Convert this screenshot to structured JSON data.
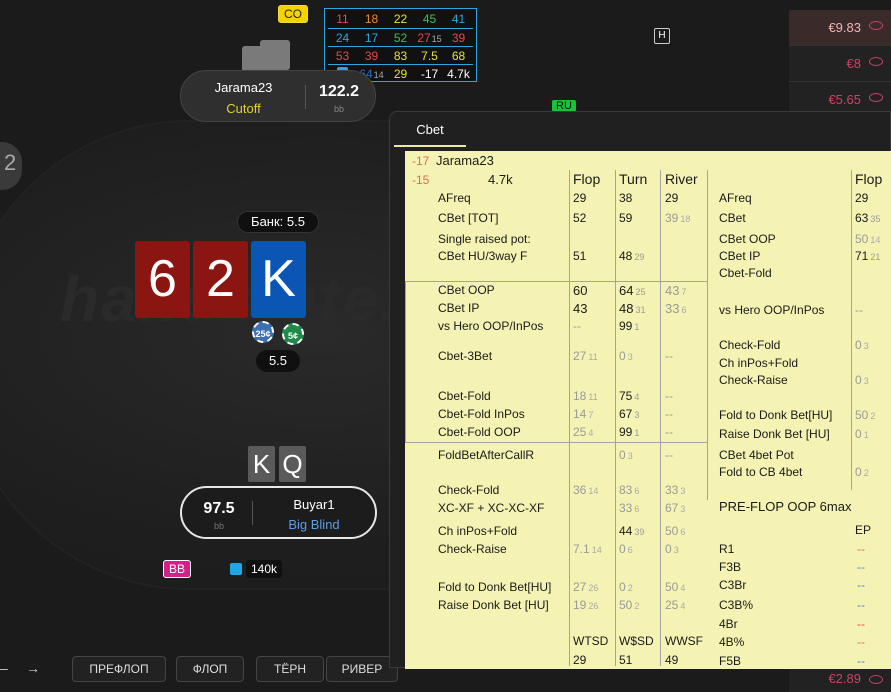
{
  "opponent": {
    "badge": "CO",
    "name": "Jarama23",
    "position": "Cutoff",
    "stack": "122.2",
    "stack_unit": "bb",
    "badge_ru": "RU"
  },
  "hud": {
    "rows": [
      [
        "11",
        "18",
        "22",
        "45",
        "41"
      ],
      [
        "24",
        "17",
        "52",
        "27",
        "39"
      ],
      [
        "53",
        "39",
        "83",
        "7.5",
        "68"
      ],
      [
        "",
        "64",
        "29",
        "-17",
        "4.7k"
      ]
    ],
    "row2_sub": "15",
    "row4_sub": "14",
    "colors": {
      "red": "#e64a4a",
      "orange": "#f08a2a",
      "yellow": "#e8e03a",
      "green": "#3ac24a",
      "cyan": "#2aa6e0"
    }
  },
  "pot": {
    "label": "Банк: 5.5",
    "amount": "5.5",
    "chips": [
      "25¢",
      "5¢"
    ]
  },
  "board": [
    "6",
    "2",
    "K"
  ],
  "hero": {
    "cards": [
      "K",
      "Q"
    ],
    "name": "Buyar1",
    "position": "Big Blind",
    "stack": "97.5",
    "stack_unit": "bb",
    "badge": "BB",
    "bet": "140k"
  },
  "streets": [
    "ПРЕФЛОП",
    "ФЛОП",
    "ТЁРН",
    "РИВЕР"
  ],
  "side_amounts": [
    "€9.83",
    "€8",
    "€5.65"
  ],
  "bottom_amount": "€2.89",
  "popup": {
    "tab": "Cbet",
    "player": "Jarama23",
    "n1": "-17",
    "n2": "-15",
    "hands": "4.7k",
    "headers": {
      "flop": "Flop",
      "turn": "Turn",
      "river": "River",
      "right_flop": "Flop"
    },
    "left": [
      {
        "label": "AFreq",
        "f": "29",
        "t": "38",
        "r": "29"
      },
      {
        "label": "CBet [TOT]",
        "f": "52",
        "t": "59",
        "r": "39",
        "r_sub": "18"
      },
      {
        "label": "Single raised pot:"
      },
      {
        "label": "CBet HU/3way F",
        "f": "51",
        "t": "48",
        "t_sub": "29"
      },
      {
        "label": "CBet OOP",
        "f": "60",
        "t": "64",
        "t_sub": "25",
        "r": "43",
        "r_sub": "7"
      },
      {
        "label": "CBet IP",
        "f": "43",
        "t": "48",
        "t_sub": "31",
        "r": "33",
        "r_sub": "6"
      },
      {
        "label": "vs Hero OOP/InPos",
        "f": "--",
        "t": "99",
        "t_sub": "1"
      },
      {
        "label": "Cbet-3Bet",
        "f": "27",
        "f_sub": "11",
        "t": "0",
        "t_sub": "3",
        "r": "--"
      },
      {
        "label": "Cbet-Fold",
        "f": "18",
        "f_sub": "11",
        "t": "75",
        "t_sub": "4",
        "r": "--"
      },
      {
        "label": "Cbet-Fold InPos",
        "f": "14",
        "f_sub": "7",
        "t": "67",
        "t_sub": "3",
        "r": "--"
      },
      {
        "label": "Cbet-Fold OOP",
        "f": "25",
        "f_sub": "4",
        "t": "99",
        "t_sub": "1",
        "r": "--"
      },
      {
        "label": "FoldBetAfterCallR",
        "t": "0",
        "t_sub": "3",
        "r": "--"
      },
      {
        "label": "Check-Fold",
        "f": "36",
        "f_sub": "14",
        "t": "83",
        "t_sub": "6",
        "r": "33",
        "r_sub": "3"
      },
      {
        "label": "XC-XF + XC-XC-XF",
        "t": "33",
        "t_sub": "6",
        "r": "67",
        "r_sub": "3"
      },
      {
        "label": "Ch inPos+Fold",
        "t": "44",
        "t_sub": "39",
        "r": "50",
        "r_sub": "6"
      },
      {
        "label": "Check-Raise",
        "f": "7.1",
        "f_sub": "14",
        "t": "0",
        "t_sub": "6",
        "r": "0",
        "r_sub": "3"
      },
      {
        "label": "Fold to Donk Bet[HU]",
        "f": "27",
        "f_sub": "26",
        "t": "0",
        "t_sub": "2",
        "r": "50",
        "r_sub": "4"
      },
      {
        "label": "Raise Donk Bet [HU]",
        "f": "19",
        "f_sub": "26",
        "t": "50",
        "t_sub": "2",
        "r": "25",
        "r_sub": "4"
      }
    ],
    "bottom_headers": [
      "WTSD",
      "W$SD",
      "WWSF"
    ],
    "bottom_values": [
      "29",
      "51",
      "49"
    ],
    "right": [
      {
        "label": "AFreq",
        "v": "29"
      },
      {
        "label": "CBet",
        "v": "63",
        "sub": "35"
      },
      {
        "label": "CBet OOP",
        "v": "50",
        "sub": "14"
      },
      {
        "label": "CBet IP",
        "v": "71",
        "sub": "21"
      },
      {
        "label": "Cbet-Fold"
      },
      {
        "label": "vs Hero OOP/InPos",
        "v": "--"
      },
      {
        "label": "Check-Fold",
        "v": "0",
        "sub": "3"
      },
      {
        "label": "Ch inPos+Fold"
      },
      {
        "label": "Check-Raise",
        "v": "0",
        "sub": "3"
      },
      {
        "label": "Fold to Donk Bet[HU]",
        "v": "50",
        "sub": "2"
      },
      {
        "label": "Raise Donk Bet [HU]",
        "v": "0",
        "sub": "1"
      },
      {
        "label": "CBet 4bet Pot"
      },
      {
        "label": "Fold to CB 4bet",
        "v": "0",
        "sub": "2"
      }
    ],
    "preflop_title": "PRE-FLOP OOP 6max",
    "preflop_col": "EP",
    "preflop_rows": [
      {
        "label": "R1",
        "v": "--"
      },
      {
        "label": "F3B",
        "v": "--"
      },
      {
        "label": "C3Br",
        "v": "--"
      },
      {
        "label": "C3B%",
        "v": "--"
      },
      {
        "label": "4Br",
        "v": "--"
      },
      {
        "label": "4B%",
        "v": "--"
      },
      {
        "label": "F5B",
        "v": "--"
      }
    ]
  }
}
